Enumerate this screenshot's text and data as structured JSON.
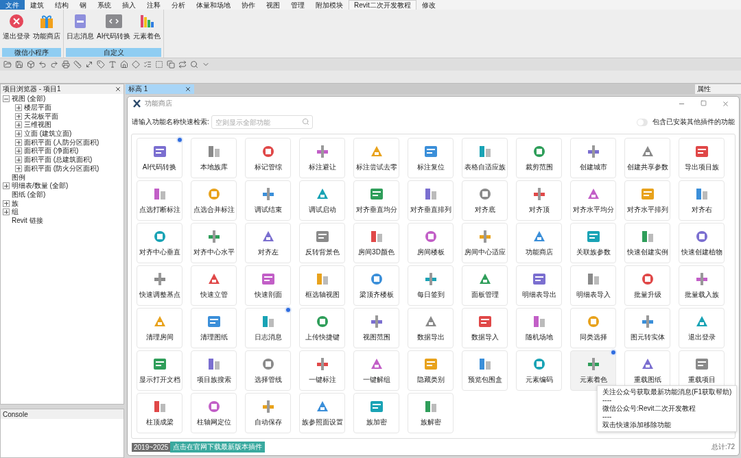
{
  "ribbon_tabs": [
    {
      "label": "文件",
      "selected": false,
      "kind": "file"
    },
    {
      "label": "建筑",
      "selected": false,
      "kind": "tab"
    },
    {
      "label": "结构",
      "selected": false,
      "kind": "tab"
    },
    {
      "label": "钢",
      "selected": false,
      "kind": "tab"
    },
    {
      "label": "系统",
      "selected": false,
      "kind": "tab"
    },
    {
      "label": "插入",
      "selected": false,
      "kind": "tab"
    },
    {
      "label": "注释",
      "selected": false,
      "kind": "tab"
    },
    {
      "label": "分析",
      "selected": false,
      "kind": "tab"
    },
    {
      "label": "体量和场地",
      "selected": false,
      "kind": "tab"
    },
    {
      "label": "协作",
      "selected": false,
      "kind": "tab"
    },
    {
      "label": "视图",
      "selected": false,
      "kind": "tab"
    },
    {
      "label": "管理",
      "selected": false,
      "kind": "tab"
    },
    {
      "label": "附加模块",
      "selected": false,
      "kind": "tab"
    },
    {
      "label": "Revit二次开发教程",
      "selected": true,
      "kind": "tab"
    },
    {
      "label": "修改",
      "selected": false,
      "kind": "tab"
    }
  ],
  "ribbon_panels": [
    {
      "title": "微信小程序",
      "buttons": [
        "退出登录",
        "功能商店"
      ]
    },
    {
      "title": "自定义",
      "buttons": [
        "日志消息",
        "AI代码转换",
        "元素着色"
      ]
    }
  ],
  "project_browser": {
    "title": "项目浏览器 - 项目1",
    "tree": [
      {
        "label": "视图 (全部)",
        "expanded": true,
        "children": [
          {
            "label": "楼层平面",
            "expanded": false
          },
          {
            "label": "天花板平面",
            "expanded": false
          },
          {
            "label": "三维视图",
            "expanded": false
          },
          {
            "label": "立面 (建筑立面)",
            "expanded": false
          },
          {
            "label": "面积平面 (人防分区面积)",
            "expanded": false
          },
          {
            "label": "面积平面 (净面积)",
            "expanded": false
          },
          {
            "label": "面积平面 (总建筑面积)",
            "expanded": false
          },
          {
            "label": "面积平面 (防火分区面积)",
            "expanded": false
          }
        ]
      },
      {
        "label": "图例"
      },
      {
        "label": "明细表/数量 (全部)",
        "expanded": false
      },
      {
        "label": "图纸 (全部)"
      },
      {
        "label": "族",
        "expanded": false
      },
      {
        "label": "组",
        "expanded": false
      },
      {
        "label": "Revit 链接"
      }
    ]
  },
  "console": {
    "title": "Console"
  },
  "view_tab": {
    "label": "标高 1"
  },
  "properties": {
    "title": "属性"
  },
  "dialog": {
    "title": "功能商店",
    "search_label": "请输入功能名称快速检索:",
    "search_placeholder": "空则显示全部功能",
    "toggle": {
      "label": "包含已安装其他插件的功能",
      "on": false
    },
    "tiles": [
      {
        "label": "AI代码转换",
        "badge": true,
        "selected": false
      },
      {
        "label": "本地族库",
        "badge": false,
        "selected": false
      },
      {
        "label": "标记管综",
        "badge": false,
        "selected": false
      },
      {
        "label": "标注避让",
        "badge": false,
        "selected": false
      },
      {
        "label": "标注尝试去零",
        "badge": false,
        "selected": false
      },
      {
        "label": "标注复位",
        "badge": false,
        "selected": false
      },
      {
        "label": "表格自适应族",
        "badge": false,
        "selected": false
      },
      {
        "label": "裁剪范围",
        "badge": false,
        "selected": false
      },
      {
        "label": "创建城市",
        "badge": false,
        "selected": false
      },
      {
        "label": "创建共享参数",
        "badge": false,
        "selected": false
      },
      {
        "label": "导出项目族",
        "badge": false,
        "selected": false
      },
      {
        "label": "点选打断标注",
        "badge": false,
        "selected": false
      },
      {
        "label": "点选合并标注",
        "badge": false,
        "selected": false
      },
      {
        "label": "调试结束",
        "badge": false,
        "selected": false
      },
      {
        "label": "调试启动",
        "badge": false,
        "selected": false
      },
      {
        "label": "对齐垂直均分",
        "badge": false,
        "selected": false
      },
      {
        "label": "对齐垂直排列",
        "badge": false,
        "selected": false
      },
      {
        "label": "对齐底",
        "badge": false,
        "selected": false
      },
      {
        "label": "对齐顶",
        "badge": false,
        "selected": false
      },
      {
        "label": "对齐水平均分",
        "badge": false,
        "selected": false
      },
      {
        "label": "对齐水平排列",
        "badge": false,
        "selected": false
      },
      {
        "label": "对齐右",
        "badge": false,
        "selected": false
      },
      {
        "label": "对齐中心垂直",
        "badge": false,
        "selected": false
      },
      {
        "label": "对齐中心水平",
        "badge": false,
        "selected": false
      },
      {
        "label": "对齐左",
        "badge": false,
        "selected": false
      },
      {
        "label": "反转背景色",
        "badge": false,
        "selected": false
      },
      {
        "label": "房间3D颜色",
        "badge": false,
        "selected": false
      },
      {
        "label": "房间楼板",
        "badge": false,
        "selected": false
      },
      {
        "label": "房间中心适应",
        "badge": false,
        "selected": false
      },
      {
        "label": "功能商店",
        "badge": false,
        "selected": false
      },
      {
        "label": "关联族参数",
        "badge": false,
        "selected": false
      },
      {
        "label": "快速创建实例",
        "badge": false,
        "selected": false
      },
      {
        "label": "快速创建植物",
        "badge": false,
        "selected": false
      },
      {
        "label": "快速调整基点",
        "badge": false,
        "selected": false
      },
      {
        "label": "快速立管",
        "badge": false,
        "selected": false
      },
      {
        "label": "快速剖面",
        "badge": false,
        "selected": false
      },
      {
        "label": "框选轴视图",
        "badge": false,
        "selected": false
      },
      {
        "label": "梁顶齐楼板",
        "badge": false,
        "selected": false
      },
      {
        "label": "每日签到",
        "badge": false,
        "selected": false
      },
      {
        "label": "面板管理",
        "badge": false,
        "selected": false
      },
      {
        "label": "明细表导出",
        "badge": false,
        "selected": false
      },
      {
        "label": "明细表导入",
        "badge": false,
        "selected": false
      },
      {
        "label": "批量升级",
        "badge": false,
        "selected": false
      },
      {
        "label": "批量载入族",
        "badge": false,
        "selected": false
      },
      {
        "label": "清理房间",
        "badge": false,
        "selected": false
      },
      {
        "label": "清理图纸",
        "badge": false,
        "selected": false
      },
      {
        "label": "日志消息",
        "badge": true,
        "selected": false
      },
      {
        "label": "上传快捷键",
        "badge": false,
        "selected": false
      },
      {
        "label": "视图范围",
        "badge": false,
        "selected": false
      },
      {
        "label": "数据导出",
        "badge": false,
        "selected": false
      },
      {
        "label": "数据导入",
        "badge": false,
        "selected": false
      },
      {
        "label": "随机场地",
        "badge": false,
        "selected": false
      },
      {
        "label": "同类选择",
        "badge": false,
        "selected": false
      },
      {
        "label": "图元转实体",
        "badge": false,
        "selected": false
      },
      {
        "label": "退出登录",
        "badge": false,
        "selected": false
      },
      {
        "label": "显示打开文档",
        "badge": false,
        "selected": false
      },
      {
        "label": "项目族搜索",
        "badge": false,
        "selected": false
      },
      {
        "label": "选择管线",
        "badge": false,
        "selected": false
      },
      {
        "label": "一键标注",
        "badge": false,
        "selected": false
      },
      {
        "label": "一键解组",
        "badge": false,
        "selected": false
      },
      {
        "label": "隐藏类别",
        "badge": false,
        "selected": false
      },
      {
        "label": "预览包围盒",
        "badge": false,
        "selected": false
      },
      {
        "label": "元素编码",
        "badge": false,
        "selected": false
      },
      {
        "label": "元素着色",
        "badge": true,
        "selected": true
      },
      {
        "label": "重载图纸",
        "badge": false,
        "selected": false
      },
      {
        "label": "重载项目",
        "badge": false,
        "selected": false
      },
      {
        "label": "柱顶成梁",
        "badge": false,
        "selected": false
      },
      {
        "label": "柱轴网定位",
        "badge": false,
        "selected": false
      },
      {
        "label": "自动保存",
        "badge": false,
        "selected": false
      },
      {
        "label": "族参照面设置",
        "badge": false,
        "selected": false
      },
      {
        "label": "族加密",
        "badge": false,
        "selected": false
      },
      {
        "label": "族解密",
        "badge": false,
        "selected": false
      }
    ],
    "tooltip": {
      "lines": [
        "关注公众号获取最新功能消息(F1获取帮助)",
        "----",
        "微信公众号:Revit二次开发教程",
        "----",
        "双击快速添加移除功能"
      ]
    },
    "footer": {
      "years": "2019~2025",
      "link": "点击在官网下载最新版本插件",
      "total": "总计:72"
    }
  }
}
